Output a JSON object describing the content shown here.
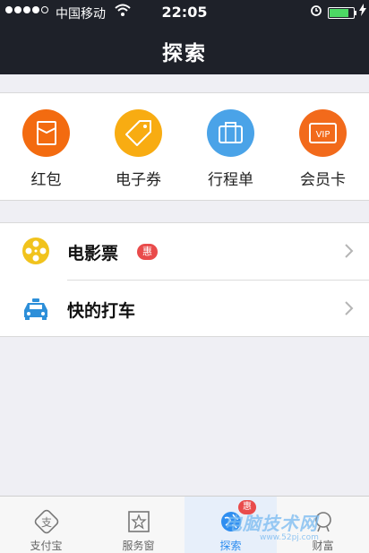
{
  "status_bar": {
    "carrier": "中国移动",
    "time": "22:05",
    "battery_level": 0.8
  },
  "header": {
    "title": "探索"
  },
  "quick_actions": [
    {
      "label": "红包",
      "color": "#f36b10",
      "icon": "envelope-icon"
    },
    {
      "label": "电子券",
      "color": "#f8ac12",
      "icon": "tag-icon"
    },
    {
      "label": "行程单",
      "color": "#4aa3e8",
      "icon": "suitcase-icon"
    },
    {
      "label": "会员卡",
      "color": "#f26a1b",
      "icon": "vip-card-icon",
      "icon_text": "VIP"
    }
  ],
  "list_items": [
    {
      "label": "电影票",
      "badge": "惠",
      "icon": "film-reel-icon",
      "icon_color": "#f1c31d"
    },
    {
      "label": "快的打车",
      "icon": "taxi-icon",
      "icon_color": "#2d8fd9"
    }
  ],
  "tab_bar": {
    "tabs": [
      {
        "label": "支付宝",
        "icon": "alipay-icon"
      },
      {
        "label": "服务窗",
        "icon": "star-window-icon"
      },
      {
        "label": "探索",
        "icon": "globe-icon",
        "badge": "惠",
        "active": true
      },
      {
        "label": "财富",
        "icon": "wealth-icon"
      }
    ]
  },
  "watermark": {
    "text": "电脑技术网",
    "url": "www.52pj.com"
  }
}
